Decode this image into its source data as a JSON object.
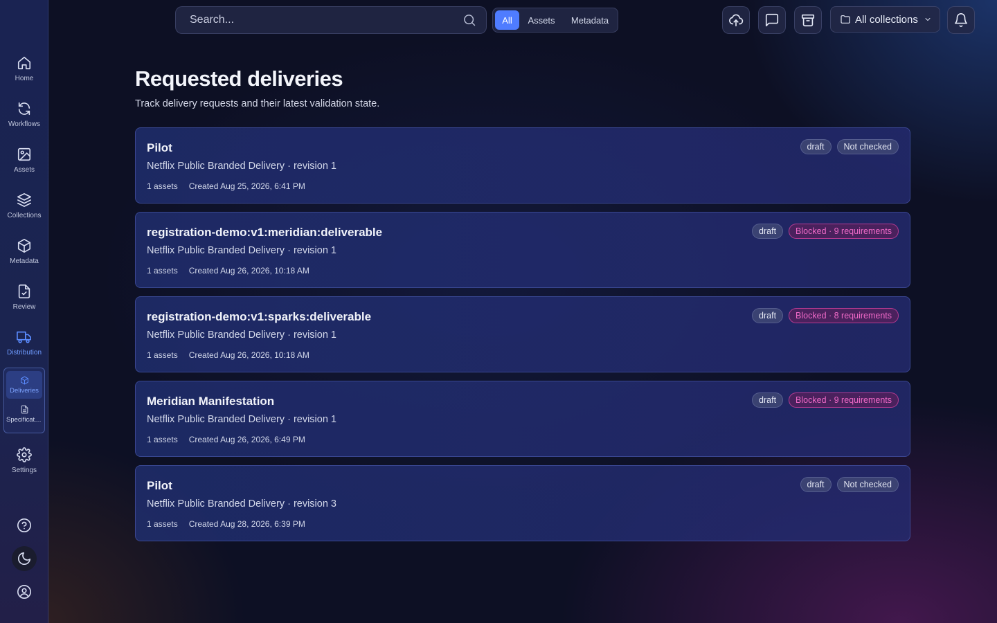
{
  "sidebar": {
    "items": [
      {
        "label": "Home",
        "icon": "home-icon"
      },
      {
        "label": "Workflows",
        "icon": "refresh-icon"
      },
      {
        "label": "Assets",
        "icon": "image-icon"
      },
      {
        "label": "Collections",
        "icon": "layers-icon"
      },
      {
        "label": "Metadata",
        "icon": "cube-icon"
      },
      {
        "label": "Review",
        "icon": "file-check-icon"
      },
      {
        "label": "Distribution",
        "icon": "truck-icon"
      }
    ],
    "subitems": [
      {
        "label": "Deliveries",
        "icon": "package-icon"
      },
      {
        "label": "Specifications",
        "icon": "file-text-icon"
      }
    ],
    "settings_label": "Settings",
    "accent_color": "#5b8cff"
  },
  "search": {
    "placeholder": "Search..."
  },
  "filters": {
    "all": "All",
    "assets": "Assets",
    "metadata": "Metadata",
    "active": "All"
  },
  "toolbar": {
    "collections_label": "All collections"
  },
  "main": {
    "title": "Requested deliveries",
    "subtitle": "Track delivery requests and their latest validation state."
  },
  "deliveries": [
    {
      "title": "Pilot",
      "spec": "Netflix Public Branded Delivery · revision 1",
      "assets": "1 assets",
      "created": "Created Aug 25, 2026, 6:41 PM",
      "status": "draft",
      "validation": "Not checked",
      "validation_kind": "neutral"
    },
    {
      "title": "registration-demo:v1:meridian:deliverable",
      "spec": "Netflix Public Branded Delivery · revision 1",
      "assets": "1 assets",
      "created": "Created Aug 26, 2026, 10:18 AM",
      "status": "draft",
      "validation": "Blocked · 9 requirements",
      "validation_kind": "blocked"
    },
    {
      "title": "registration-demo:v1:sparks:deliverable",
      "spec": "Netflix Public Branded Delivery · revision 1",
      "assets": "1 assets",
      "created": "Created Aug 26, 2026, 10:18 AM",
      "status": "draft",
      "validation": "Blocked · 8 requirements",
      "validation_kind": "blocked"
    },
    {
      "title": "Meridian Manifestation",
      "spec": "Netflix Public Branded Delivery · revision 1",
      "assets": "1 assets",
      "created": "Created Aug 26, 2026, 6:49 PM",
      "status": "draft",
      "validation": "Blocked · 9 requirements",
      "validation_kind": "blocked"
    },
    {
      "title": "Pilot",
      "spec": "Netflix Public Branded Delivery · revision 3",
      "assets": "1 assets",
      "created": "Created Aug 28, 2026, 6:39 PM",
      "status": "draft",
      "validation": "Not checked",
      "validation_kind": "neutral"
    }
  ]
}
